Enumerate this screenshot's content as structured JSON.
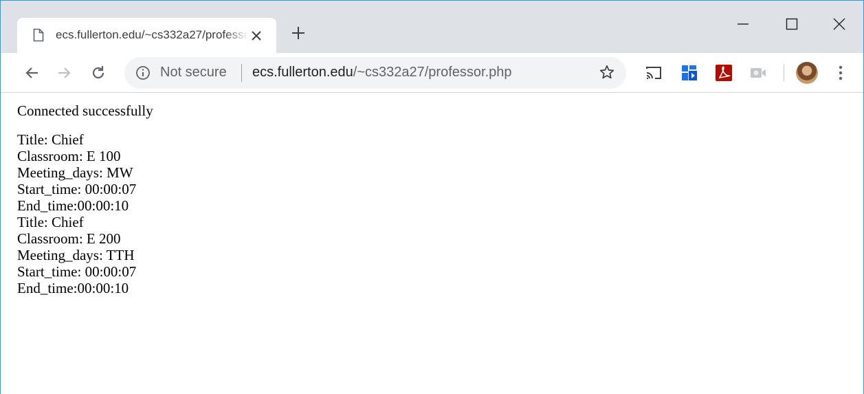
{
  "browser": {
    "tab_title": "ecs.fullerton.edu/~cs332a27/professor.php",
    "security_label": "Not secure",
    "url_host": "ecs.fullerton.edu",
    "url_path": "/~cs332a27/professor.php"
  },
  "colors": {
    "accent": "#2b9bd6",
    "titlebar": "#dee1e6",
    "omnibox": "#f1f3f4"
  },
  "icons": [
    "page-icon",
    "close-icon",
    "plus-icon",
    "minimize-icon",
    "maximize-icon",
    "window-close-icon",
    "back-arrow-icon",
    "forward-arrow-icon",
    "reload-icon",
    "info-icon",
    "star-icon",
    "cast-icon",
    "extension-icon",
    "pdf-icon",
    "camera-icon",
    "avatar",
    "more-menu-icon"
  ],
  "page": {
    "status": "Connected successfully",
    "lines": [
      "Title: Chief",
      "Classroom: E 100",
      "Meeting_days: MW",
      "Start_time: 00:00:07",
      "End_time:00:00:10",
      "Title: Chief",
      "Classroom: E 200",
      "Meeting_days: TTH",
      "Start_time: 00:00:07",
      "End_time:00:00:10"
    ]
  }
}
